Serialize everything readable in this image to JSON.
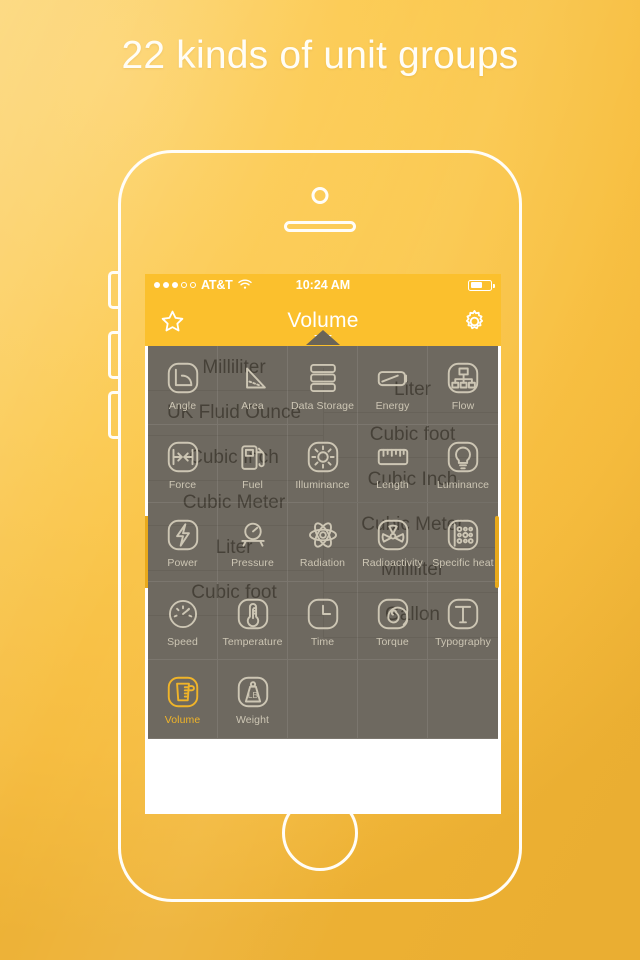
{
  "headline": "22 kinds of unit groups",
  "colors": {
    "background": "#fbc84b",
    "nav_bar": "#fbc02d",
    "accent_gold": "#f0b429",
    "grid_overlay": "#4a4438",
    "grid_label": "#cdc6b4",
    "phone_outline": "#fffdf8",
    "list_text": "#3a3a3a"
  },
  "phone": {
    "camera": "camera-icon",
    "speaker": "speaker-grille",
    "home_button": "home-button",
    "side_buttons": [
      "mute-switch",
      "volume-up-button",
      "volume-down-button"
    ]
  },
  "status_bar": {
    "signal_filled": 3,
    "signal_total": 5,
    "carrier": "AT&T",
    "wifi": "wifi-icon",
    "time": "10:24 AM",
    "battery_icon": "battery-icon",
    "battery_level": 62
  },
  "nav_bar": {
    "left_icon": "star-icon",
    "title": "Volume",
    "caret": "chevron-down-icon",
    "right_icon": "gear-icon"
  },
  "unit_list": {
    "left_column": [
      "Milliliter",
      "UK Fluid Ounce",
      "Cubic Inch",
      "Cubic Meter",
      "Liter",
      "Cubic foot"
    ],
    "right_column": [
      "Liter",
      "Cubic foot",
      "Cubic Inch",
      "Cubic Meter",
      "Milliliter",
      "Gallon"
    ]
  },
  "grid": {
    "selected": "Volume",
    "items": [
      {
        "label": "Angle",
        "icon": "angle-icon"
      },
      {
        "label": "Area",
        "icon": "area-icon"
      },
      {
        "label": "Data Storage",
        "icon": "data-storage-icon"
      },
      {
        "label": "Energy",
        "icon": "energy-icon"
      },
      {
        "label": "Flow",
        "icon": "flow-icon"
      },
      {
        "label": "Force",
        "icon": "force-icon"
      },
      {
        "label": "Fuel",
        "icon": "fuel-icon"
      },
      {
        "label": "Illuminance",
        "icon": "illuminance-icon"
      },
      {
        "label": "Length",
        "icon": "length-icon"
      },
      {
        "label": "Luminance",
        "icon": "luminance-icon"
      },
      {
        "label": "Power",
        "icon": "power-icon"
      },
      {
        "label": "Pressure",
        "icon": "pressure-icon"
      },
      {
        "label": "Radiation",
        "icon": "radiation-icon"
      },
      {
        "label": "Radioactivity",
        "icon": "radioactivity-icon"
      },
      {
        "label": "Specific heat",
        "icon": "specific-heat-icon"
      },
      {
        "label": "Speed",
        "icon": "speed-icon"
      },
      {
        "label": "Temperature",
        "icon": "temperature-icon"
      },
      {
        "label": "Time",
        "icon": "time-icon"
      },
      {
        "label": "Torque",
        "icon": "torque-icon"
      },
      {
        "label": "Typography",
        "icon": "typography-icon"
      },
      {
        "label": "Volume",
        "icon": "volume-icon"
      },
      {
        "label": "Weight",
        "icon": "weight-icon"
      }
    ]
  }
}
